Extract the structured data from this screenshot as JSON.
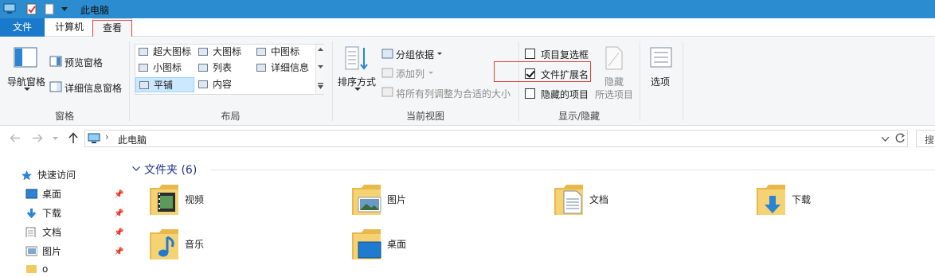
{
  "window": {
    "title": "此电脑"
  },
  "tabs": {
    "file": "文件",
    "computer": "计算机",
    "view": "查看"
  },
  "ribbon": {
    "panes": {
      "nav_pane": "导航窗格",
      "preview_pane": "预览窗格",
      "details_pane": "详细信息窗格",
      "group_label": "窗格"
    },
    "layout": {
      "items": [
        "超大图标",
        "大图标",
        "中图标",
        "小图标",
        "列表",
        "详细信息",
        "平铺",
        "内容"
      ],
      "selected": "平铺",
      "group_label": "布局"
    },
    "current_view": {
      "sort_by": "排序方式",
      "group_by": "分组依据",
      "add_columns": "添加列",
      "fit_columns": "将所有列调整为合适的大小",
      "group_label": "当前视图"
    },
    "show_hide": {
      "item_checkboxes": {
        "label": "项目复选框",
        "checked": false
      },
      "file_extensions": {
        "label": "文件扩展名",
        "checked": true
      },
      "hidden_items": {
        "label": "隐藏的项目",
        "checked": false
      },
      "hide_selected_line1": "隐藏",
      "hide_selected_line2": "所选项目",
      "group_label": "显示/隐藏"
    },
    "options": "选项"
  },
  "address": {
    "path": "此电脑",
    "search_placeholder": "搜"
  },
  "nav_pane": {
    "quick_access": "快速访问",
    "items": [
      "桌面",
      "下载",
      "文档",
      "图片",
      "o"
    ]
  },
  "content": {
    "section_title": "文件夹 (6)",
    "folders": [
      "视频",
      "图片",
      "文档",
      "下载",
      "音乐",
      "桌面"
    ]
  },
  "colors": {
    "accent": "#1979ca",
    "titlebar": "#2b8ccf",
    "highlight": "#e0403a",
    "selected": "#cce8ff"
  }
}
